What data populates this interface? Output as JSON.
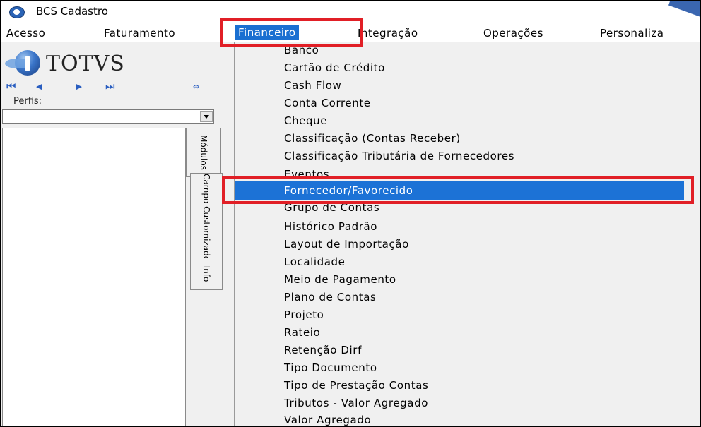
{
  "window": {
    "title": "BCS Cadastro"
  },
  "menubar": {
    "items": [
      {
        "label": "Acesso"
      },
      {
        "label": "Faturamento"
      },
      {
        "label": "Financeiro"
      },
      {
        "label": "Integração"
      },
      {
        "label": "Operações"
      },
      {
        "label": "Personaliza"
      }
    ]
  },
  "sidebar": {
    "logo_text": "TOTVS",
    "nav": {
      "first": "⏮",
      "prev": "◀",
      "next": "▶",
      "last": "⏭",
      "swap": "⇔"
    },
    "perfis_label": "Perfis:",
    "perfis_value": "",
    "tabs": [
      {
        "label": "Módulos"
      },
      {
        "label": "Campo Customizado"
      },
      {
        "label": "Info"
      }
    ]
  },
  "financeiro_menu": {
    "items": [
      {
        "label": "Banco"
      },
      {
        "label": "Cartão de Crédito"
      },
      {
        "label": "Cash Flow"
      },
      {
        "label": "Conta Corrente"
      },
      {
        "label": "Cheque"
      },
      {
        "label": "Classificação (Contas Receber)"
      },
      {
        "label": "Classificação Tributária de Fornecedores"
      },
      {
        "label": "Eventos"
      },
      {
        "label": "Fornecedor/Favorecido"
      },
      {
        "label": "Grupo de Contas"
      },
      {
        "label": "Histórico Padrão"
      },
      {
        "label": "Layout de Importação"
      },
      {
        "label": "Localidade"
      },
      {
        "label": "Meio de Pagamento"
      },
      {
        "label": "Plano de Contas"
      },
      {
        "label": "Projeto"
      },
      {
        "label": "Rateio"
      },
      {
        "label": "Retenção Dirf"
      },
      {
        "label": "Tipo Documento"
      },
      {
        "label": "Tipo de Prestação Contas"
      },
      {
        "label": "Tributos - Valor Agregado"
      },
      {
        "label": "Valor Agregado"
      }
    ],
    "selected": "Fornecedor/Favorecido"
  },
  "colors": {
    "highlight_box": "#e11f26",
    "selection": "#1c72d6"
  }
}
